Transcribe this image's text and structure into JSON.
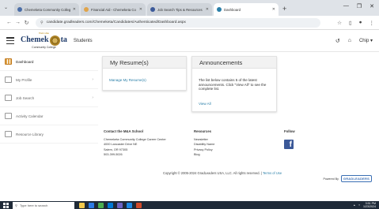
{
  "browser": {
    "tabs": [
      {
        "label": "Chemeketa Community Colleg",
        "color": "#4a6da7",
        "active": false
      },
      {
        "label": "Financial Aid - Chemeketa Co",
        "color": "#e0a44a",
        "active": false
      },
      {
        "label": "Job Search Tips & Resources",
        "color": "#3c5a99",
        "active": false
      },
      {
        "label": "Dashboard",
        "color": "#2a7fa8",
        "active": true
      }
    ],
    "new_tab": "+",
    "url": "candidate.gradleaders.com/Chemeketa/Candidates/Authenticated/Dashboard.aspx"
  },
  "header": {
    "logo_welcome": "Welcome",
    "logo_brand_left": "Chemek",
    "logo_brand_right": "ta",
    "logo_sub": "Community College",
    "title": "Students",
    "user": "Chip"
  },
  "sidebar": {
    "items": [
      {
        "label": "Dashboard",
        "active": true,
        "chevron": false
      },
      {
        "label": "My Profile",
        "active": false,
        "chevron": true
      },
      {
        "label": "Job Search",
        "active": false,
        "chevron": true
      },
      {
        "label": "Activity Calendar",
        "active": false,
        "chevron": false
      },
      {
        "label": "Resource Library",
        "active": false,
        "chevron": false
      }
    ]
  },
  "cards": {
    "resume": {
      "title": "My Resume(s)",
      "link": "Manage My Resume(s)"
    },
    "announcements": {
      "title": "Announcements",
      "body": "The list below contains 5 of the latest announcements. Click \"View All\" to see the complete list.",
      "view_all": "View All"
    }
  },
  "footer": {
    "contact": {
      "heading": "Contact the M&A School",
      "lines": [
        "Chemeketa Community College Career Center",
        "4000 Lancaster Drive NE",
        "Salem, OR 97305",
        "503-399-5026"
      ]
    },
    "resources": {
      "heading": "Resources",
      "lines": [
        "Newsletter",
        "Disability Name",
        "Privacy Policy",
        "Blog"
      ]
    },
    "follow": {
      "heading": "Follow",
      "facebook": "f"
    },
    "copyright": "Copyright © 2005-2024 GradLeaders USA, LLC. All rights reserved. |",
    "terms": "Terms of Use",
    "powered_by": "Powered By",
    "powered_logo": "GRADLEADERS"
  },
  "taskbar": {
    "search_placeholder": "Type here to search",
    "time": "3:51 PM",
    "date": "1/23/2024"
  }
}
